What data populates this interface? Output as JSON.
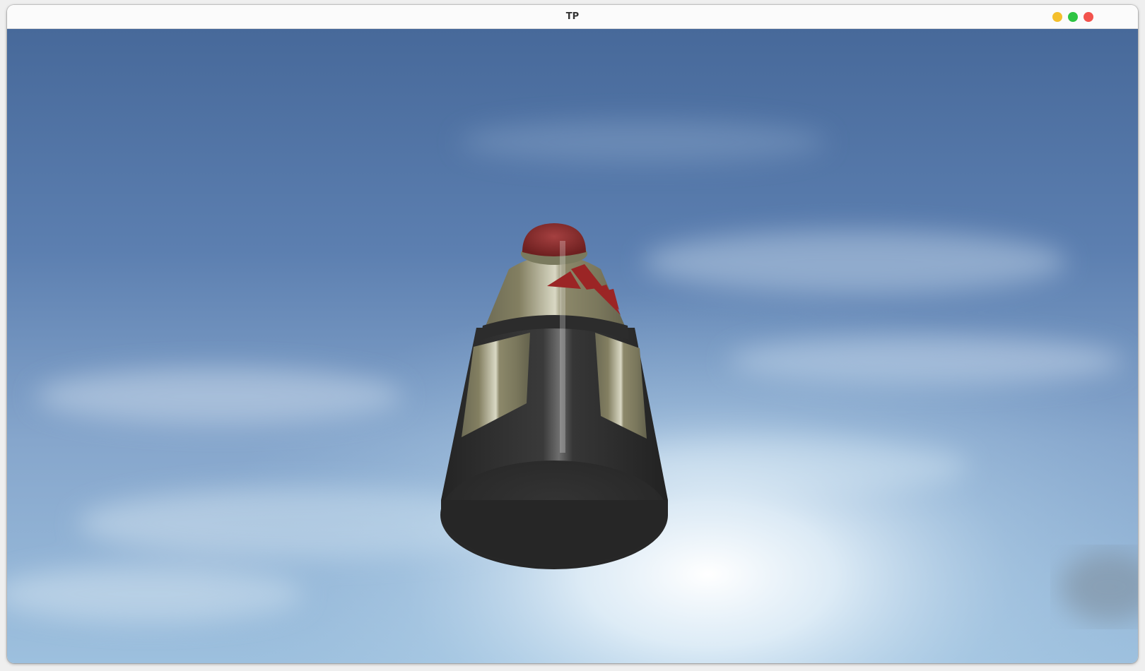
{
  "window": {
    "title": "TP",
    "controls": [
      {
        "name": "minimize",
        "color": "#f4bf2c"
      },
      {
        "name": "maximize",
        "color": "#2ec443"
      },
      {
        "name": "close",
        "color": "#f2534d"
      }
    ]
  },
  "scene": {
    "background": "sky-skybox",
    "object": "bottle",
    "colors": {
      "sky_top": "#4a6f9f",
      "sky_mid": "#7d9cc4",
      "sky_glow": "#ffffff",
      "bottle_cap": "#8b2a2a",
      "bottle_label": "#7a7a5e",
      "bottle_body": "#2f2f2f",
      "logo": "#9b2525"
    }
  }
}
